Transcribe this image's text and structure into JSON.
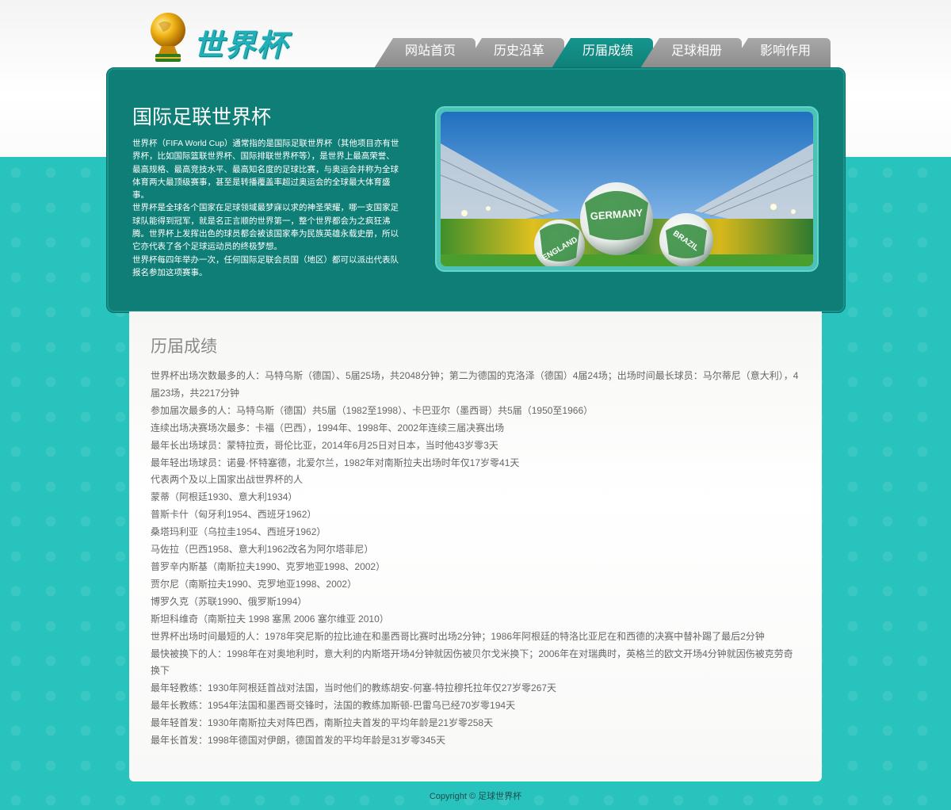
{
  "logo": {
    "text": "世界杯"
  },
  "nav": {
    "tabs": [
      {
        "label": "网站首页",
        "active": false
      },
      {
        "label": "历史沿革",
        "active": false
      },
      {
        "label": "历届成绩",
        "active": true
      },
      {
        "label": "足球相册",
        "active": false
      },
      {
        "label": "影响作用",
        "active": false
      }
    ]
  },
  "hero": {
    "title": "国际足联世界杯",
    "paragraphs": [
      "世界杯（FIFA World Cup）通常指的是国际足联世界杯（其他项目亦有世界杯，比如国际篮联世界杯、国际排联世界杯等），是世界上最高荣誉、最高规格、最高竞技水平、最高知名度的足球比赛，与奥运会并称为全球体育两大最顶级赛事，甚至是转播覆盖率超过奥运会的全球最大体育盛事。",
      "世界杯是全球各个国家在足球领域最梦寐以求的神圣荣耀，哪一支国家足球队能得到冠军，就是名正言顺的世界第一，整个世界都会为之疯狂沸腾。世界杯上发挥出色的球员都会被该国家奉为民族英雄永载史册，所以它亦代表了各个足球运动员的终极梦想。",
      "世界杯每四年举办一次，任何国际足联会员国（地区）都可以派出代表队报名参加这项赛事。"
    ],
    "image_ball_labels": [
      "GERMANY",
      "ENGLAND",
      "BRAZIL"
    ]
  },
  "content": {
    "title": "历届成绩",
    "lines": [
      "世界杯出场次数最多的人：马特乌斯（德国）、5届25场，共2048分钟；第二为德国的克洛泽（德国）4届24场；出场时间最长球员：马尔蒂尼（意大利），4届23场，共2217分钟",
      "参加届次最多的人：马特乌斯（德国）共5届（1982至1998）、卡巴亚尔（墨西哥）共5届（1950至1966）",
      "连续出场决赛场次最多：卡福（巴西），1994年、1998年、2002年连续三届决赛出场",
      "最年长出场球员：蒙特拉贡，哥伦比亚，2014年6月25日对日本，当时他43岁零3天",
      "最年轻出场球员：诺曼·怀特塞德，北爱尔兰，1982年对南斯拉夫出场时年仅17岁零41天",
      "代表两个及以上国家出战世界杯的人",
      "蒙蒂（阿根廷1930、意大利1934）",
      "普斯卡什（匈牙利1954、西班牙1962）",
      "桑塔玛利亚（乌拉圭1954、西班牙1962）",
      "马佐拉（巴西1958、意大利1962改名为阿尔塔菲尼）",
      "普罗辛内斯基（南斯拉夫1990、克罗地亚1998、2002）",
      "贾尔尼（南斯拉夫1990、克罗地亚1998、2002）",
      "博罗久克（苏联1990、俄罗斯1994）",
      "斯坦科维奇（南斯拉夫 1998 塞黑 2006 塞尔维亚 2010）",
      "世界杯出场时间最短的人：1978年突尼斯的拉比迪在和墨西哥比赛时出场2分钟；1986年阿根廷的特洛比亚尼在和西德的决赛中替补踢了最后2分钟",
      "最快被换下的人：1998年在对奥地利时，意大利的内斯塔开场4分钟就因伤被贝尔戈米换下；2006年在对瑞典时，英格兰的欧文开场4分钟就因伤被克劳奇换下",
      "最年轻教练：1930年阿根廷首战对法国，当时他们的教练胡安-何塞-特拉穆托拉年仅27岁零267天",
      "最年长教练：1954年法国和墨西哥交锋时，法国的教练加斯顿-巴雷乌已经70岁零194天",
      "最年轻首发：1930年南斯拉夫对阵巴西，南斯拉夫首发的平均年龄是21岁零258天",
      "最年长首发：1998年德国对伊朗，德国首发的平均年龄是31岁零345天"
    ]
  },
  "footer": {
    "text": "Copyright © 足球世界杯"
  },
  "colors": {
    "background_teal": "#28c3bd",
    "panel_dark_teal": "#0f7e76",
    "active_tab": "#14968d",
    "inactive_tab": "#999999",
    "logo_text": "#22b0b8"
  }
}
